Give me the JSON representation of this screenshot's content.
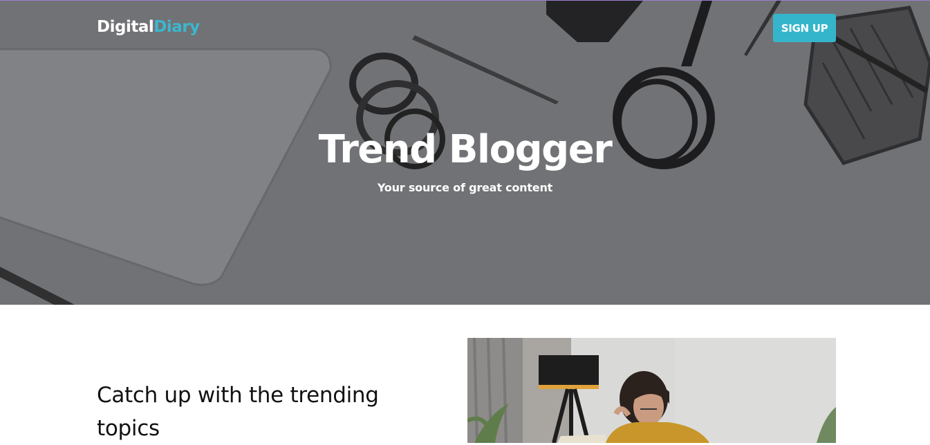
{
  "header": {
    "logo_primary": "Digital",
    "logo_accent": "Diary",
    "signup_label": "SIGN UP"
  },
  "hero": {
    "title": "Trend Blogger",
    "subtitle": "Your source of great content"
  },
  "intro": {
    "heading": "Catch up with the trending topics"
  },
  "colors": {
    "accent": "#35b5cc",
    "hero_background": "#7a7b7e",
    "text_dark": "#111111"
  }
}
